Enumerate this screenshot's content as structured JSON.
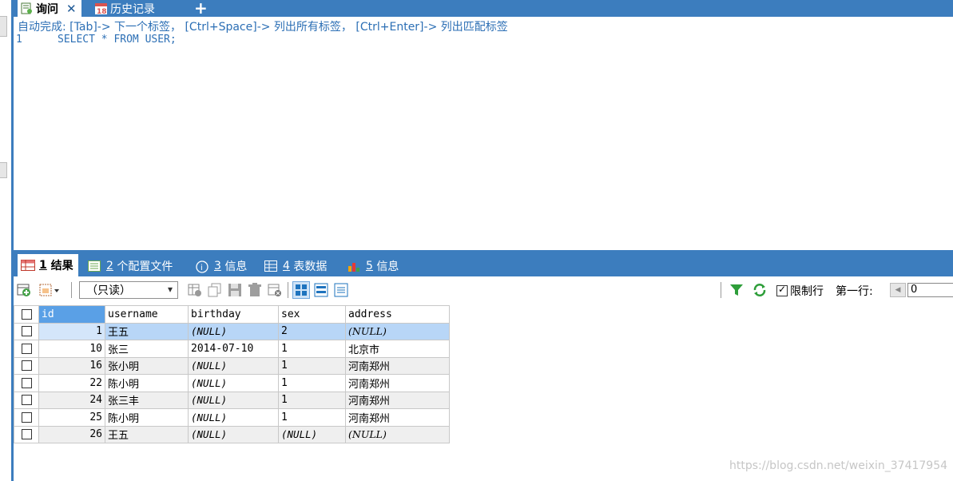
{
  "top_tabs": [
    {
      "label": "询问",
      "icon": "query-icon",
      "active": true
    },
    {
      "label": "历史记录",
      "icon": "calendar-18-icon",
      "active": false
    }
  ],
  "editor": {
    "hint": "自动完成: [Tab]-> 下一个标签， [Ctrl+Space]-> 列出所有标签， [Ctrl+Enter]-> 列出匹配标签",
    "line_number": "1",
    "sql": "SELECT * FROM USER;"
  },
  "result_tabs": [
    {
      "num": "1",
      "label": "结果",
      "icon": "grid-icon",
      "active": true
    },
    {
      "num": "2",
      "label": "个配置文件",
      "icon": "profile-icon",
      "active": false
    },
    {
      "num": "3",
      "label": "信息",
      "icon": "info-icon",
      "active": false
    },
    {
      "num": "4",
      "label": "表数据",
      "icon": "table-icon",
      "active": false
    },
    {
      "num": "5",
      "label": "信息",
      "icon": "chart-icon",
      "active": false
    }
  ],
  "toolbar": {
    "readonly_select": "（只读）",
    "limit_label": "限制行",
    "first_row_label": "第一行:",
    "first_row_value": "0"
  },
  "grid": {
    "columns": [
      "id",
      "username",
      "birthday",
      "sex",
      "address"
    ],
    "rows": [
      {
        "id": "1",
        "username": "王五",
        "birthday": "(NULL)",
        "sex": "2",
        "address": "(NULL)"
      },
      {
        "id": "10",
        "username": "张三",
        "birthday": "2014-07-10",
        "sex": "1",
        "address": "北京市"
      },
      {
        "id": "16",
        "username": "张小明",
        "birthday": "(NULL)",
        "sex": "1",
        "address": "河南郑州"
      },
      {
        "id": "22",
        "username": "陈小明",
        "birthday": "(NULL)",
        "sex": "1",
        "address": "河南郑州"
      },
      {
        "id": "24",
        "username": "张三丰",
        "birthday": "(NULL)",
        "sex": "1",
        "address": "河南郑州"
      },
      {
        "id": "25",
        "username": "陈小明",
        "birthday": "(NULL)",
        "sex": "1",
        "address": "河南郑州"
      },
      {
        "id": "26",
        "username": "王五",
        "birthday": "(NULL)",
        "sex": "(NULL)",
        "address": "(NULL)"
      }
    ]
  },
  "watermark": "https://blog.csdn.net/weixin_37417954",
  "colors": {
    "accent": "#3c7dbe",
    "selected_row": "#b8d6f7",
    "header_selected": "#5aa0e6"
  }
}
